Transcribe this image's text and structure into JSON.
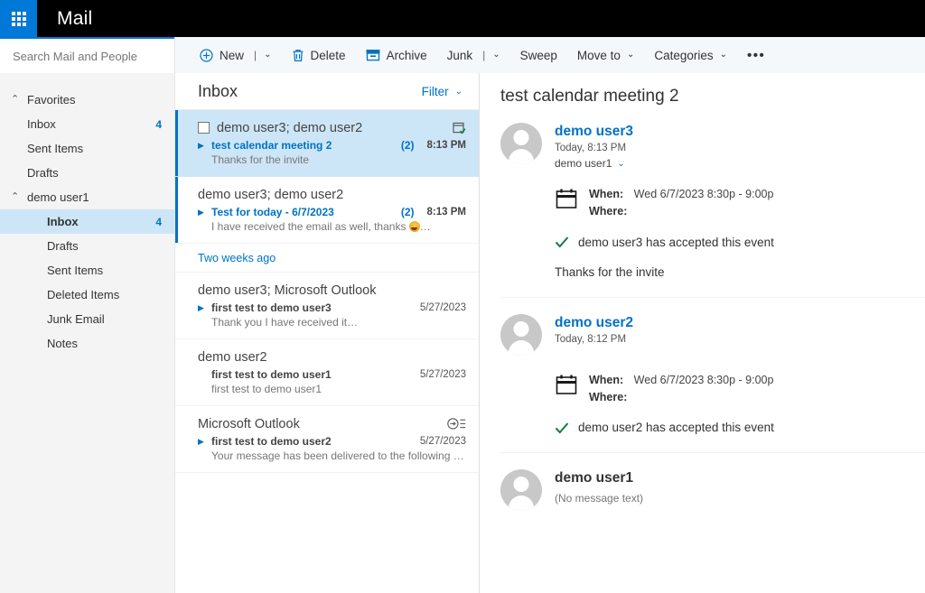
{
  "suite": {
    "waffle_icon": "app-launcher-icon",
    "app_title": "Mail"
  },
  "search": {
    "placeholder": "Search Mail and People",
    "value": "",
    "icon": "search-icon"
  },
  "toolbar": {
    "items": [
      {
        "label": "New",
        "icon": "plus-circle-icon",
        "split": "|",
        "caret": "⌄"
      },
      {
        "label": "Delete",
        "icon": "trash-icon"
      },
      {
        "label": "Archive",
        "icon": "archive-box-icon"
      },
      {
        "label": "Junk",
        "split": "|",
        "caret": "⌄"
      },
      {
        "label": "Sweep"
      },
      {
        "label": "Move to",
        "caret": "⌄"
      },
      {
        "label": "Categories",
        "caret": "⌄"
      },
      {
        "label": "•••",
        "name": "more-commands"
      }
    ]
  },
  "nav": {
    "groups": [
      {
        "label": "Favorites",
        "chevron": "⌃",
        "items": [
          {
            "label": "Inbox",
            "count": "4",
            "selected": false
          },
          {
            "label": "Sent Items",
            "count": "",
            "selected": false
          },
          {
            "label": "Drafts",
            "count": "",
            "selected": false
          }
        ]
      },
      {
        "label": "demo user1",
        "chevron": "⌃",
        "items": [
          {
            "label": "Inbox",
            "count": "4",
            "selected": true
          },
          {
            "label": "Drafts",
            "count": "",
            "selected": false
          },
          {
            "label": "Sent Items",
            "count": "",
            "selected": false
          },
          {
            "label": "Deleted Items",
            "count": "",
            "selected": false
          },
          {
            "label": "Junk Email",
            "count": "",
            "selected": false
          },
          {
            "label": "Notes",
            "count": "",
            "selected": false
          }
        ]
      }
    ]
  },
  "list": {
    "title": "Inbox",
    "filter_label": "Filter",
    "filter_caret": "⌄",
    "group_label": "Two weeks ago",
    "messages": [
      {
        "from": "demo user3; demo user2",
        "subject": "test calendar meeting 2",
        "count": "(2)",
        "date": "8:13 PM",
        "preview": "Thanks for the invite",
        "preview_rule": false,
        "selected": true,
        "unread": true,
        "checkbox": true,
        "expander": true,
        "badge": "calendar-accepted-icon"
      },
      {
        "from": "demo user3; demo user2",
        "subject": "Test for today - 6/7/2023",
        "count": "(2)",
        "date": "8:13 PM",
        "preview": "I have received the email as well, thanks",
        "preview_emoji": true,
        "preview_rule": true,
        "preview_tail": "...",
        "selected": false,
        "unread": true,
        "checkbox": false,
        "expander": true,
        "badge": ""
      },
      {
        "from": "demo user3; Microsoft Outlook",
        "subject": "first test to demo user3",
        "count": "",
        "date": "5/27/2023",
        "preview": "Thank you I have received it",
        "preview_rule": true,
        "preview_tail": "...",
        "selected": false,
        "unread": false,
        "checkbox": false,
        "expander": true,
        "badge": ""
      },
      {
        "from": "demo user2",
        "subject": "first test to demo user1",
        "count": "",
        "date": "5/27/2023",
        "preview": "first test to demo user1",
        "preview_rule": false,
        "selected": false,
        "unread": false,
        "checkbox": false,
        "expander": false,
        "badge": ""
      },
      {
        "from": "Microsoft Outlook",
        "subject": "first test to demo user2",
        "count": "",
        "date": "5/27/2023",
        "preview": "Your message has been delivered to the following recipi...",
        "preview_rule": false,
        "selected": false,
        "unread": false,
        "checkbox": false,
        "expander": true,
        "badge": "delivery-report-icon"
      }
    ]
  },
  "reading": {
    "subject": "test calendar meeting 2",
    "messages": [
      {
        "sender": "demo user3",
        "sender_is_link": true,
        "when": "Today, 8:13 PM",
        "recipients": "demo user1",
        "recipients_caret": "⌄",
        "meeting": {
          "when_label": "When:",
          "when_value": "Wed 6/7/2023 8:30p - 9:00p",
          "where_label": "Where:",
          "where_value": ""
        },
        "accepted_text": "demo user3 has accepted this event",
        "body": "Thanks for the invite",
        "no_message": ""
      },
      {
        "sender": "demo user2",
        "sender_is_link": true,
        "when": "Today, 8:12 PM",
        "recipients": "",
        "meeting": {
          "when_label": "When:",
          "when_value": "Wed 6/7/2023 8:30p - 9:00p",
          "where_label": "Where:",
          "where_value": ""
        },
        "accepted_text": "demo user2 has accepted this event",
        "body": "",
        "no_message": ""
      },
      {
        "sender": "demo user1",
        "sender_is_link": false,
        "when": "",
        "recipients": "",
        "meeting": null,
        "accepted_text": "",
        "body": "",
        "no_message": "(No message text)"
      }
    ]
  },
  "colors": {
    "accent": "#0078d7",
    "link": "#0072c6",
    "selection": "#cde6f7",
    "suitebar": "#000000",
    "toolbar_bg": "#f4f8fb",
    "nav_bg": "#f4f4f4",
    "accept_green": "#107c41"
  }
}
